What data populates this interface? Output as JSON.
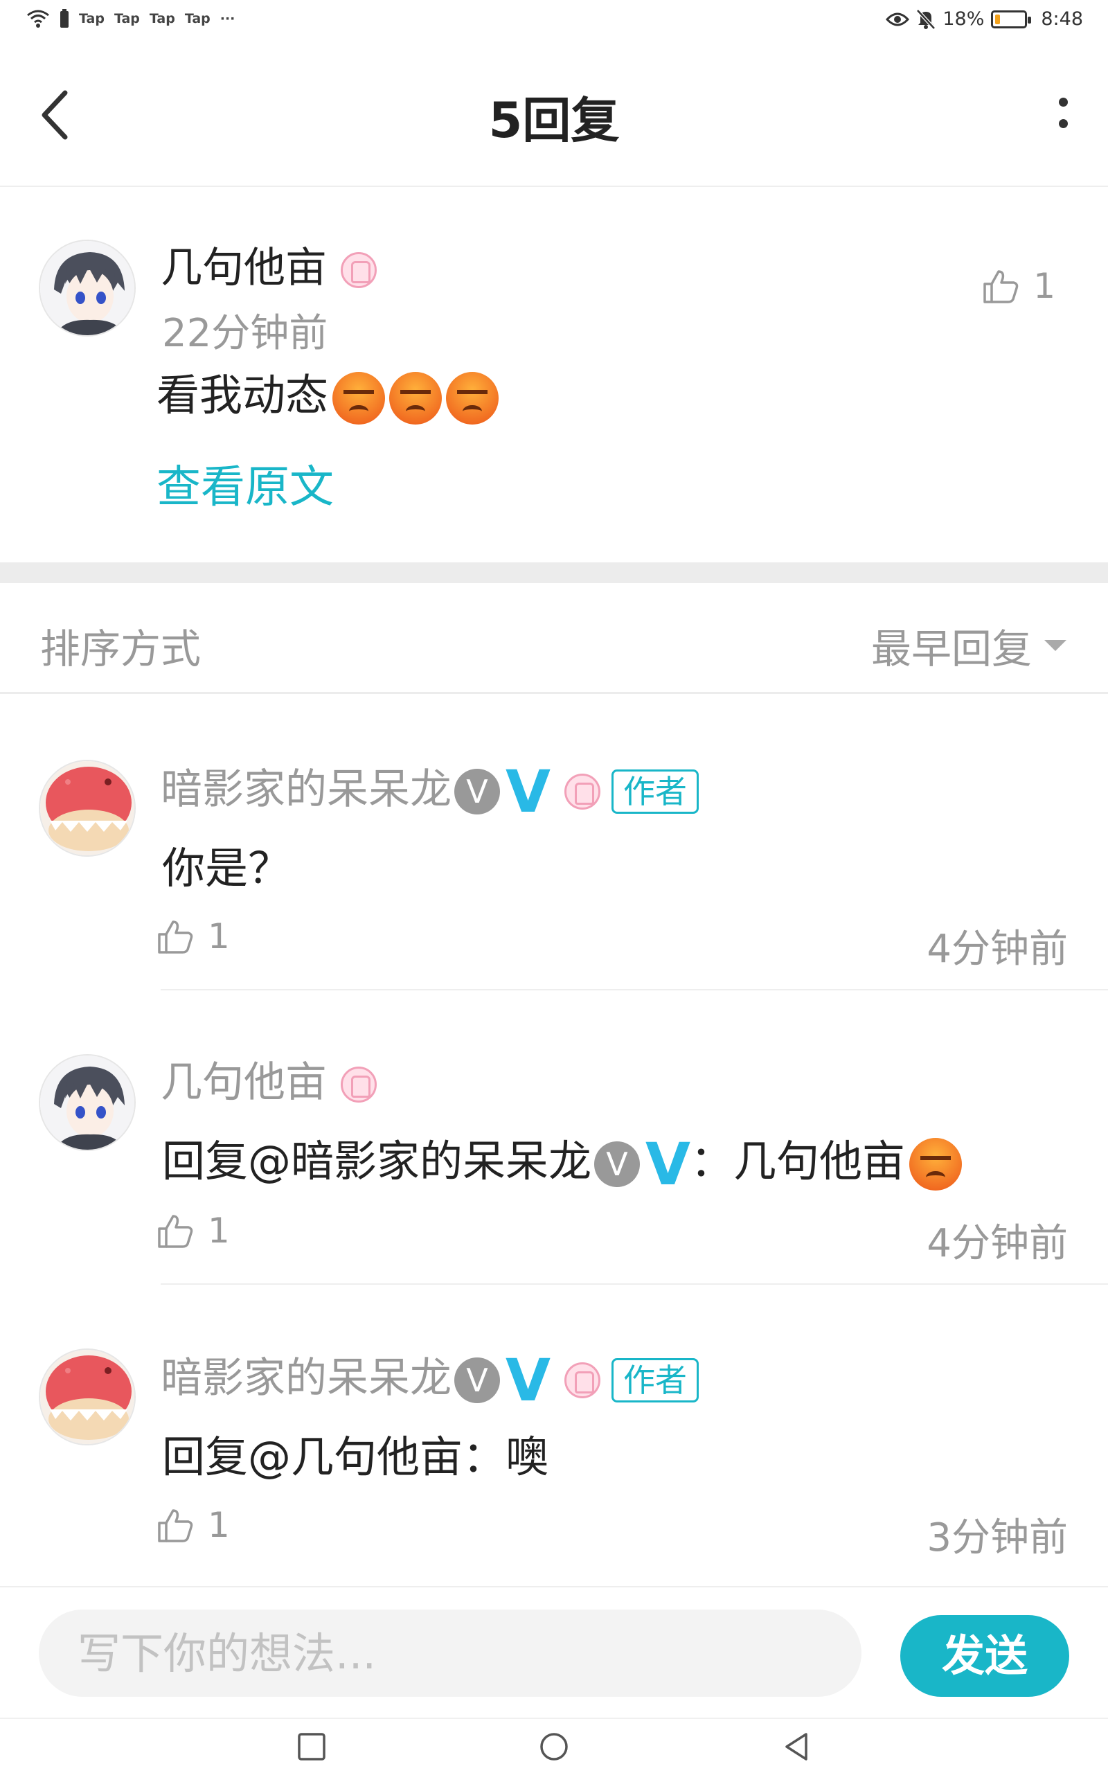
{
  "status_bar": {
    "tap_labels": [
      "Tap",
      "Tap",
      "Tap",
      "Tap"
    ],
    "more": "···",
    "battery": "18%",
    "battery_level": 0.18,
    "time": "8:48"
  },
  "header": {
    "title": "5回复"
  },
  "original_post": {
    "username": "几句他亩",
    "time": "22分钟前",
    "content": "看我动态",
    "emoji_count": 3,
    "likes": "1",
    "view_original": "查看原文"
  },
  "sort": {
    "label": "排序方式",
    "value": "最早回复"
  },
  "replies": [
    {
      "username": "暗影家的呆呆龙",
      "v_badge": "V",
      "v_check": "V",
      "author_tag": "作者",
      "content": "你是？",
      "likes": "1",
      "time": "4分钟前"
    },
    {
      "username": "几句他亩",
      "content_prefix": "回复@暗影家的呆呆龙",
      "v_badge": "V",
      "v_check": "V",
      "content_suffix": "：几句他亩",
      "likes": "1",
      "time": "4分钟前"
    },
    {
      "username": "暗影家的呆呆龙",
      "v_badge": "V",
      "v_check": "V",
      "author_tag": "作者",
      "content": "回复@几句他亩：噢",
      "likes": "1",
      "time": "3分钟前"
    }
  ],
  "composer": {
    "placeholder": "写下你的想法...",
    "send_label": "发送"
  },
  "colors": {
    "accent": "#19b6c8",
    "verified_blue": "#29b9e6",
    "muted_text": "#999999",
    "badge_pink": "#f2a0b8"
  }
}
